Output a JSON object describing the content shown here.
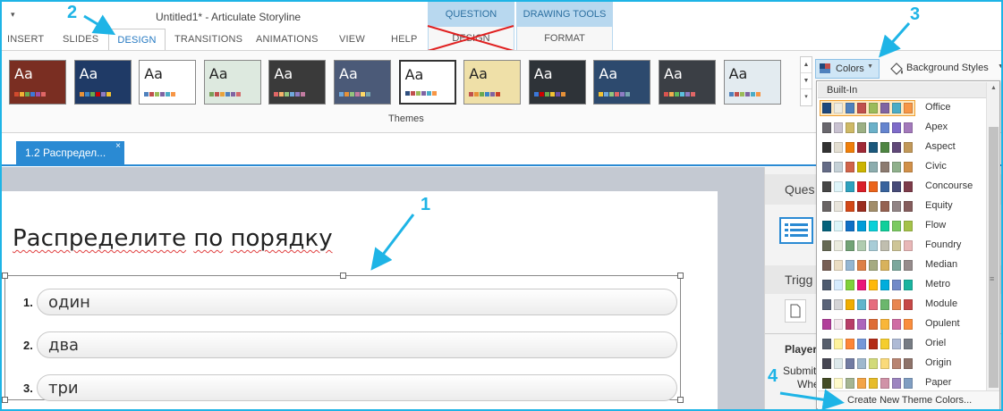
{
  "window": {
    "title": "Untitled1* - Articulate Storyline",
    "qat_arrow": "▾"
  },
  "context_tabs": {
    "question_tools": {
      "label": "QUESTION TOOLS",
      "tab": "DESIGN"
    },
    "drawing_tools": {
      "label": "DRAWING TOOLS",
      "tab": "FORMAT"
    }
  },
  "tabs": [
    "INSERT",
    "SLIDES",
    "DESIGN",
    "TRANSITIONS",
    "ANIMATIONS",
    "VIEW",
    "HELP"
  ],
  "ribbon": {
    "themes_label": "Themes",
    "colors_label": "Colors",
    "background_styles_label": "Background Styles",
    "themes": [
      {
        "aa": "Aa",
        "bg": "#7a2e22",
        "fg": "#ffffff",
        "sw": [
          "#d14a2e",
          "#f2b134",
          "#6aa84f",
          "#3c78d8",
          "#9e4ea5",
          "#e06666"
        ]
      },
      {
        "aa": "Aa",
        "bg": "#1f3a66",
        "fg": "#ffffff",
        "sw": [
          "#e69138",
          "#3d85c6",
          "#6aa84f",
          "#cc0000",
          "#8e7cc3",
          "#f1c232"
        ]
      },
      {
        "aa": "Aa",
        "bg": "#ffffff",
        "fg": "#222222",
        "sw": [
          "#4f81bd",
          "#c0504d",
          "#9bbb59",
          "#8064a2",
          "#4bacc6",
          "#f79646"
        ]
      },
      {
        "aa": "Aa",
        "bg": "#dde9df",
        "fg": "#222222",
        "sw": [
          "#7aa05a",
          "#c0504d",
          "#e8a33c",
          "#4f81bd",
          "#8064a2",
          "#d36b6b"
        ]
      },
      {
        "aa": "Aa",
        "bg": "#3a3a3a",
        "fg": "#ffffff",
        "sw": [
          "#e06666",
          "#f6b26b",
          "#93c47d",
          "#6fa8dc",
          "#8e7cc3",
          "#c27ba0"
        ]
      },
      {
        "aa": "Aa",
        "bg": "#4b5a78",
        "fg": "#ffffff",
        "sw": [
          "#6fa8dc",
          "#e69138",
          "#93c47d",
          "#c27ba0",
          "#ffd966",
          "#76a5af"
        ]
      },
      {
        "aa": "Aa",
        "bg": "#ffffff",
        "fg": "#222222",
        "sw": [
          "#2f4f7f",
          "#c0504d",
          "#9bbb59",
          "#8064a2",
          "#4bacc6",
          "#f79646"
        ]
      },
      {
        "aa": "Aa",
        "bg": "#efe0a8",
        "fg": "#222222",
        "sw": [
          "#c0504d",
          "#e69138",
          "#6aa84f",
          "#3d85c6",
          "#8064a2",
          "#cc4125"
        ]
      },
      {
        "aa": "Aa",
        "bg": "#2e3338",
        "fg": "#ffffff",
        "sw": [
          "#3c78d8",
          "#cc0000",
          "#6aa84f",
          "#f1c232",
          "#674ea7",
          "#e69138"
        ]
      },
      {
        "aa": "Aa",
        "bg": "#2d4a6e",
        "fg": "#ffffff",
        "sw": [
          "#f1c232",
          "#6fa8dc",
          "#93c47d",
          "#e06666",
          "#8e7cc3",
          "#76a5af"
        ]
      },
      {
        "aa": "Aa",
        "bg": "#3b3f45",
        "fg": "#ffffff",
        "sw": [
          "#d9534f",
          "#f0ad4e",
          "#5cb85c",
          "#5bc0de",
          "#8e7cc3",
          "#e06666"
        ]
      },
      {
        "aa": "Aa",
        "bg": "#e3ebf0",
        "fg": "#222222",
        "sw": [
          "#4f81bd",
          "#c0504d",
          "#9bbb59",
          "#8064a2",
          "#4bacc6",
          "#f79646"
        ]
      }
    ]
  },
  "slide_tab": {
    "label": "1.2 Распредел...",
    "close": "×"
  },
  "slide": {
    "title_words": [
      "Распределите",
      "по",
      "порядку"
    ],
    "items": [
      {
        "num": "1.",
        "text": "один"
      },
      {
        "num": "2.",
        "text": "два"
      },
      {
        "num": "3.",
        "text": "три"
      }
    ]
  },
  "side_panel": {
    "ques": "Ques",
    "trigg": "Trigg",
    "player": "Player",
    "submit": "Submit",
    "whe": "Whe"
  },
  "colors_dropdown": {
    "header": "Built-In",
    "create_label": "Create New Theme Colors...",
    "schemes": [
      {
        "name": "Office",
        "selected": true,
        "sw": [
          "#1f497d",
          "#eeece1",
          "#4f81bd",
          "#c0504d",
          "#9bbb59",
          "#8064a2",
          "#4bacc6",
          "#f79646"
        ]
      },
      {
        "name": "Apex",
        "selected": false,
        "sw": [
          "#69676d",
          "#c9c2d1",
          "#ceb966",
          "#9cb084",
          "#6bb1c9",
          "#6585cf",
          "#7e6bc9",
          "#a379bb"
        ]
      },
      {
        "name": "Aspect",
        "selected": false,
        "sw": [
          "#323232",
          "#e3ded1",
          "#f07f09",
          "#9f2936",
          "#1b587c",
          "#4e8542",
          "#604878",
          "#c19859"
        ]
      },
      {
        "name": "Civic",
        "selected": false,
        "sw": [
          "#646b86",
          "#c5d1d7",
          "#d16349",
          "#ccb400",
          "#8cadae",
          "#8c7b70",
          "#8fb08c",
          "#d19049"
        ]
      },
      {
        "name": "Concourse",
        "selected": false,
        "sw": [
          "#464646",
          "#def5fa",
          "#2da2bf",
          "#da1f28",
          "#eb641b",
          "#39639d",
          "#474b78",
          "#7d3c4a"
        ]
      },
      {
        "name": "Equity",
        "selected": false,
        "sw": [
          "#696464",
          "#e9e5dc",
          "#d34817",
          "#9b2d1f",
          "#a28e6a",
          "#956251",
          "#918485",
          "#855d5d"
        ]
      },
      {
        "name": "Flow",
        "selected": false,
        "sw": [
          "#04617b",
          "#dbf5f9",
          "#0f6fc6",
          "#009dd9",
          "#0bd0d9",
          "#10cf9b",
          "#7cca62",
          "#a5c249"
        ]
      },
      {
        "name": "Foundry",
        "selected": false,
        "sw": [
          "#676a55",
          "#eaebde",
          "#72a376",
          "#b0ccb0",
          "#a8cdd7",
          "#c0beaf",
          "#cec597",
          "#e8b7b7"
        ]
      },
      {
        "name": "Median",
        "selected": false,
        "sw": [
          "#775f55",
          "#ebddc3",
          "#94b6d2",
          "#dd8047",
          "#a5ab81",
          "#d8b25c",
          "#7ba79d",
          "#968c8c"
        ]
      },
      {
        "name": "Metro",
        "selected": false,
        "sw": [
          "#4e5b6f",
          "#d6ecff",
          "#7fd13b",
          "#ea157a",
          "#feb80a",
          "#00addc",
          "#738ac8",
          "#1ab39f"
        ]
      },
      {
        "name": "Module",
        "selected": false,
        "sw": [
          "#5a6378",
          "#d4d4d6",
          "#f0ad00",
          "#60b5cc",
          "#e66c7d",
          "#6bb76d",
          "#e88651",
          "#c64847"
        ]
      },
      {
        "name": "Opulent",
        "selected": false,
        "sw": [
          "#b13f9a",
          "#f4e7ed",
          "#b83d68",
          "#ac66bb",
          "#de6c36",
          "#f9b639",
          "#cf6da4",
          "#fa8d3d"
        ]
      },
      {
        "name": "Oriel",
        "selected": false,
        "sw": [
          "#575f6d",
          "#fff39d",
          "#fe8637",
          "#7598d9",
          "#b32c16",
          "#f5cd2d",
          "#aebad5",
          "#777c84"
        ]
      },
      {
        "name": "Origin",
        "selected": false,
        "sw": [
          "#464653",
          "#dde9ec",
          "#727ca3",
          "#9fb8cd",
          "#d2da7a",
          "#fada7a",
          "#b88472",
          "#8e736a"
        ]
      },
      {
        "name": "Paper",
        "selected": false,
        "sw": [
          "#444d26",
          "#fefac9",
          "#a5b592",
          "#f3a447",
          "#e7bc29",
          "#d092a7",
          "#9c85c0",
          "#809ec2"
        ]
      }
    ]
  },
  "annotations": [
    "1",
    "2",
    "3",
    "4"
  ],
  "colors": {
    "accent": "#1eb4e6",
    "tab_blue": "#2a8ad3",
    "context": "#b8d8ef"
  }
}
